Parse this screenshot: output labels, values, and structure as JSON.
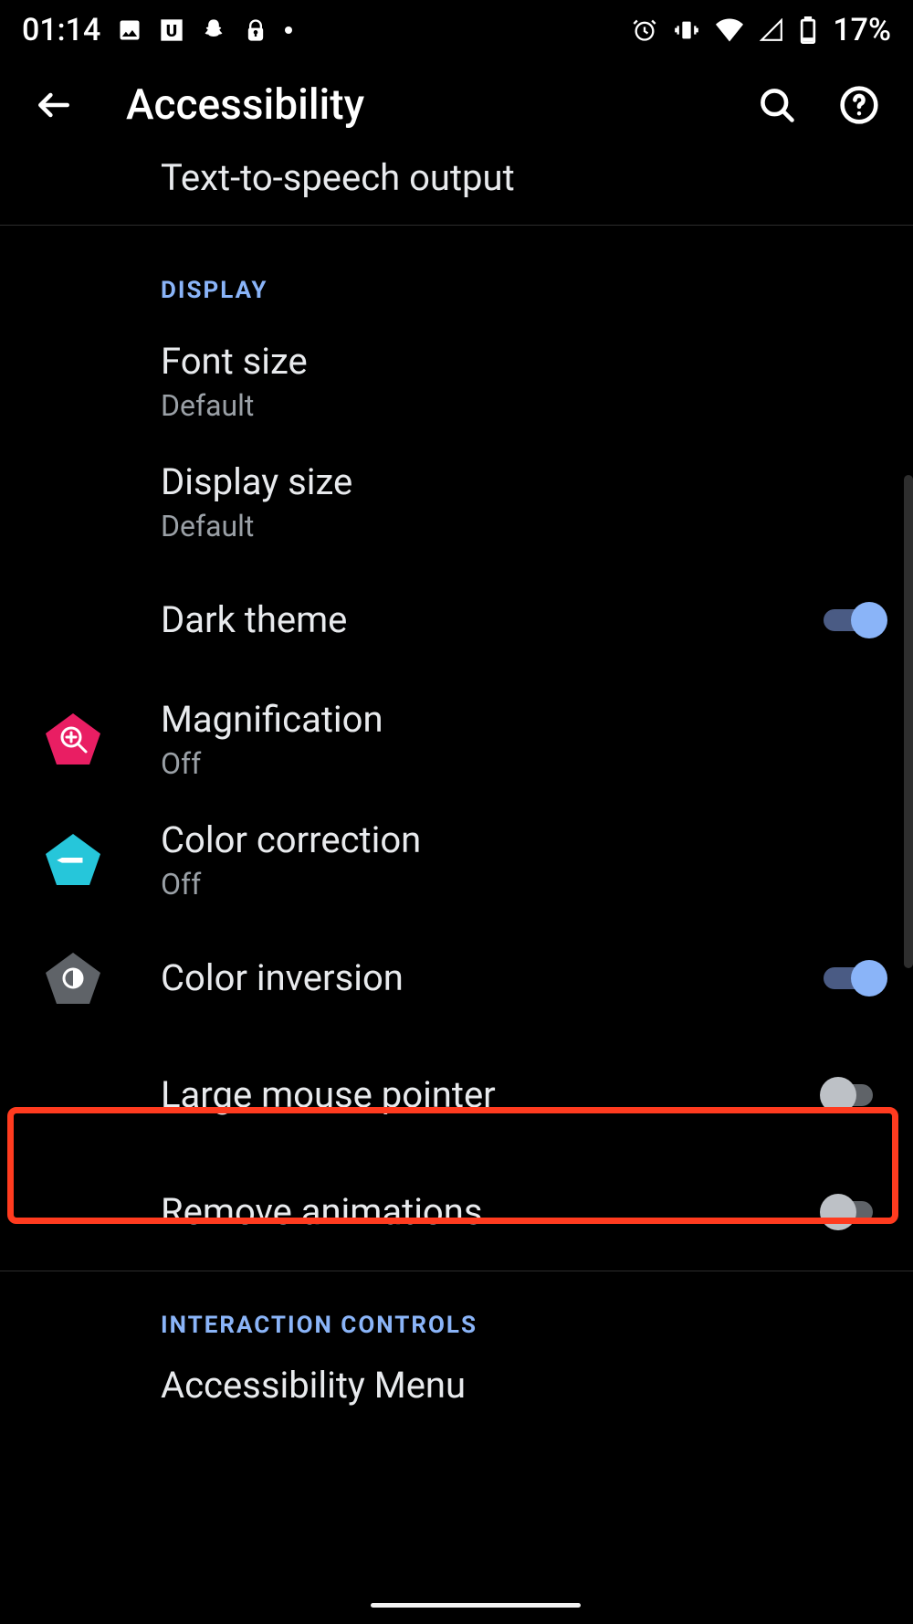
{
  "status": {
    "time": "01:14",
    "battery": "17%"
  },
  "appbar": {
    "title": "Accessibility"
  },
  "top_item": {
    "title": "Text-to-speech output"
  },
  "sections": {
    "display_header": "DISPLAY",
    "interaction_header": "INTERACTION CONTROLS"
  },
  "items": {
    "font_size": {
      "title": "Font size",
      "sub": "Default"
    },
    "display_size": {
      "title": "Display size",
      "sub": "Default"
    },
    "dark_theme": {
      "title": "Dark theme"
    },
    "magnification": {
      "title": "Magnification",
      "sub": "Off"
    },
    "color_correction": {
      "title": "Color correction",
      "sub": "Off"
    },
    "color_inversion": {
      "title": "Color inversion"
    },
    "large_pointer": {
      "title": "Large mouse pointer"
    },
    "remove_anim": {
      "title": "Remove animations"
    },
    "accessibility_menu": {
      "title": "Accessibility Menu"
    }
  },
  "colors": {
    "accent": "#8ab4f8",
    "magnification_icon": "#e91e63",
    "color_correction_icon": "#00acc1",
    "color_inversion_icon": "#5f6368",
    "accessibility_menu_icon": "#0f9d58",
    "highlight": "#ff3b1f"
  }
}
